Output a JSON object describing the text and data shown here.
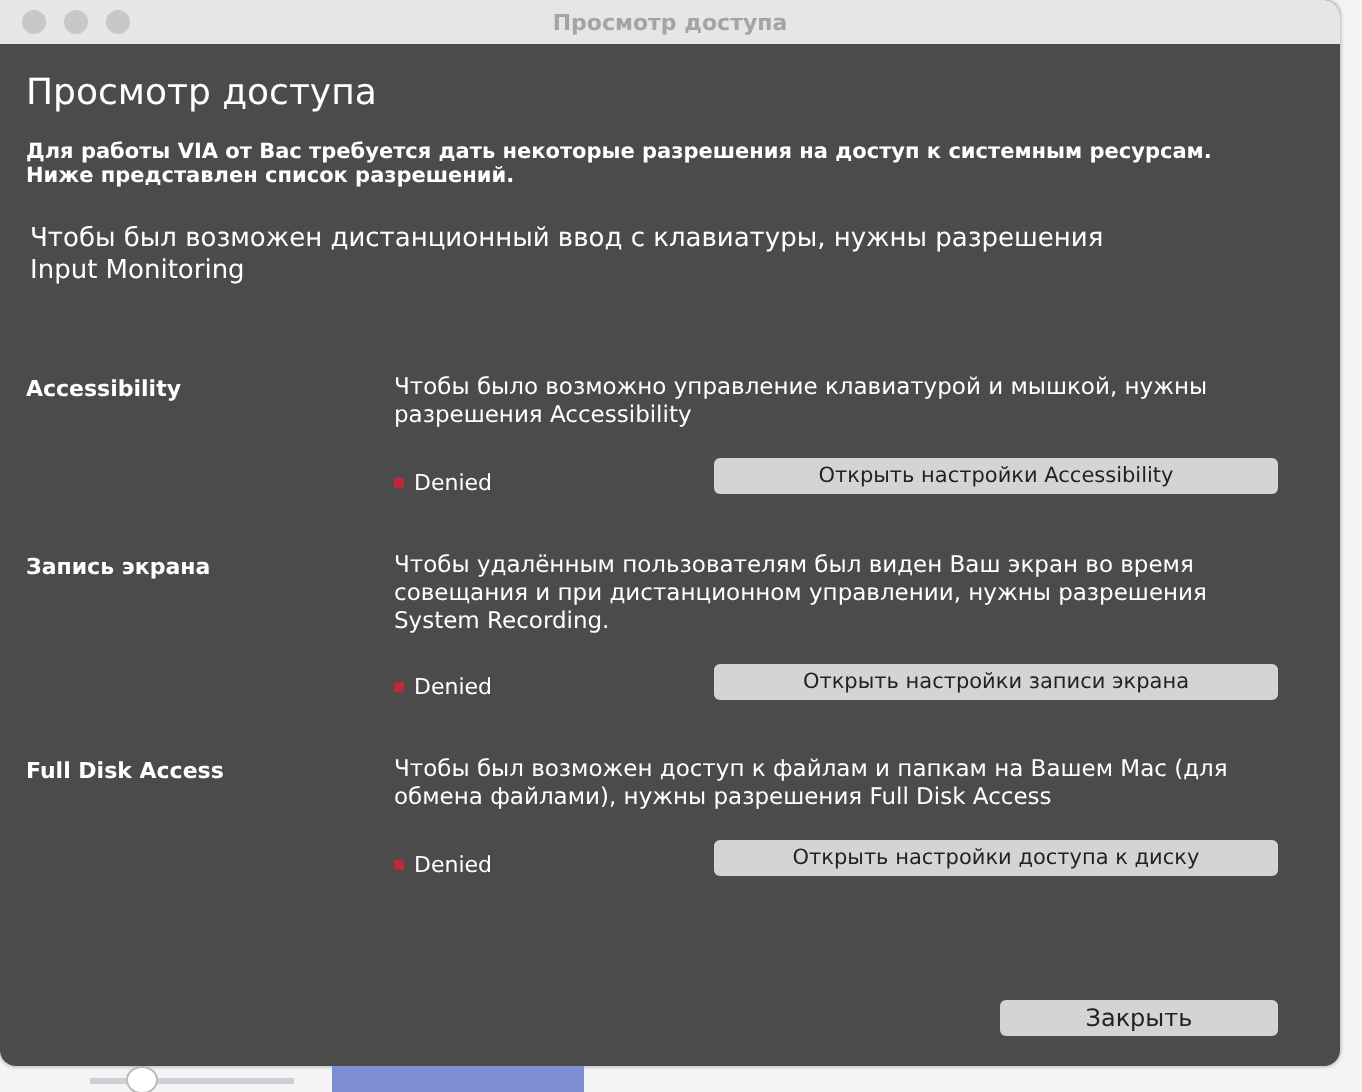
{
  "window": {
    "title": "Просмотр доступа"
  },
  "heading": "Просмотр доступа",
  "intro": "Для работы VIA от Вас требуется дать некоторые разрешения на доступ к системным ресурсам. Ниже представлен список разрешений.",
  "input_monitoring_note": "Чтобы был возможен дистанционный ввод с клавиатуры, нужны разрешения Input Monitoring",
  "permissions": [
    {
      "name": "Accessibility",
      "description": "Чтобы было возможно управление клавиатурой и мышкой, нужны разрешения Accessibility",
      "granted": false,
      "status": "Denied",
      "button": "Открыть настройки Accessibility"
    },
    {
      "name": "Запись экрана",
      "description": "Чтобы удалённым пользователям был виден Ваш экран во время совещания и при дистанционном управлении, нужны разрешения System Recording.",
      "granted": false,
      "status": "Denied",
      "button": "Открыть настройки записи экрана"
    },
    {
      "name": "Full Disk Access",
      "description": "Чтобы был возможен доступ к файлам и папкам на Вашем Mac (для обмена файлами), нужны разрешения Full Disk Access",
      "granted": false,
      "status": "Denied",
      "button": "Открыть настройки доступа к диску"
    }
  ],
  "close_button": "Закрыть",
  "background_slider": {
    "level": 0.25
  }
}
